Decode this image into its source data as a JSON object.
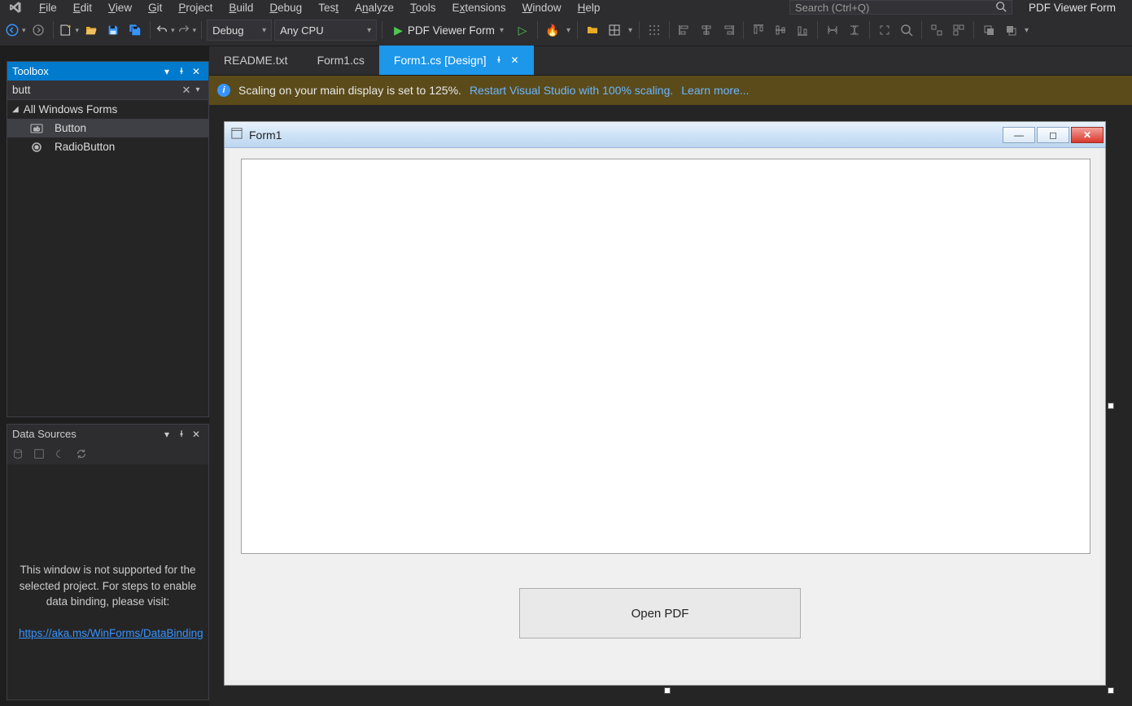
{
  "menu": {
    "items": [
      "File",
      "Edit",
      "View",
      "Git",
      "Project",
      "Build",
      "Debug",
      "Test",
      "Analyze",
      "Tools",
      "Extensions",
      "Window",
      "Help"
    ]
  },
  "search": {
    "placeholder": "Search (Ctrl+Q)"
  },
  "solution_label": "PDF Viewer Form",
  "toolbar": {
    "config": "Debug",
    "platform": "Any CPU",
    "start_label": "PDF Viewer Form"
  },
  "toolbox": {
    "title": "Toolbox",
    "search_value": "butt",
    "group": "All Windows Forms",
    "items": [
      "Button",
      "RadioButton"
    ]
  },
  "datasources": {
    "title": "Data Sources",
    "message": "This window is not supported for the selected project. For steps to enable data binding, please visit:",
    "link": "https://aka.ms/WinForms/DataBinding"
  },
  "tabs": {
    "items": [
      {
        "label": "README.txt",
        "active": false
      },
      {
        "label": "Form1.cs",
        "active": false
      },
      {
        "label": "Form1.cs [Design]",
        "active": true
      }
    ]
  },
  "infobar": {
    "text": "Scaling on your main display is set to 125%.",
    "link1": "Restart Visual Studio with 100% scaling.",
    "link2": "Learn more..."
  },
  "designer": {
    "form_title": "Form1",
    "open_button": "Open PDF"
  }
}
